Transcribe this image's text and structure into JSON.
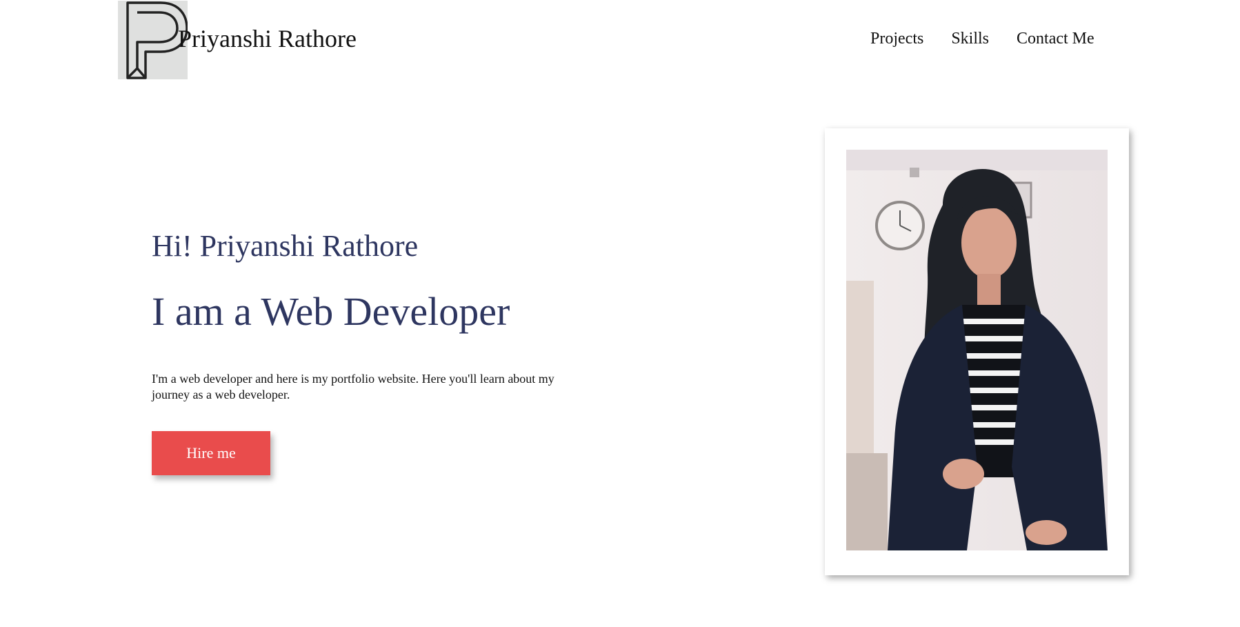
{
  "header": {
    "logo_icon": "p-monogram-logo",
    "brand_name": "Priyanshi Rathore",
    "nav": [
      {
        "label": "Projects"
      },
      {
        "label": "Skills"
      },
      {
        "label": "Contact Me"
      }
    ]
  },
  "hero": {
    "greeting": "Hi! Priyanshi Rathore",
    "headline": "I am a Web Developer",
    "intro": "I'm a web developer and here is my portfolio website. Here you'll learn about my journey as a web developer.",
    "hire_button": "Hire me"
  },
  "photo": {
    "subject": "portrait-photo"
  },
  "colors": {
    "heading": "#2e3660",
    "button": "#e94c4c",
    "logo_bg": "#dfe0df"
  }
}
